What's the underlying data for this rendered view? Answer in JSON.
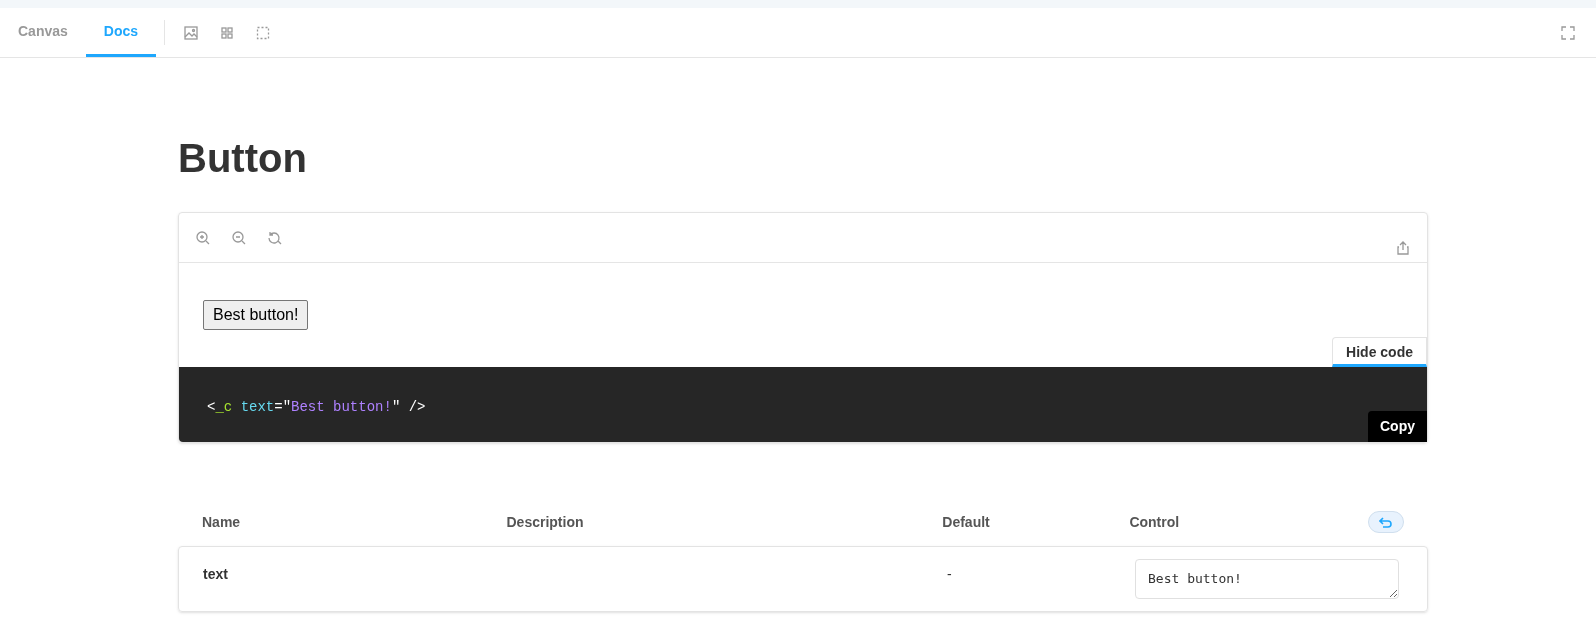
{
  "tabs": [
    {
      "label": "Canvas",
      "selected": false
    },
    {
      "label": "Docs",
      "selected": true
    }
  ],
  "title": "Button",
  "preview": {
    "button_label": "Best button!",
    "toggle_label": "Hide code",
    "code_shown": true,
    "code": [
      {
        "kind": "punct",
        "text": "<"
      },
      {
        "kind": "tag",
        "text": "_c "
      },
      {
        "kind": "attr",
        "text": "text"
      },
      {
        "kind": "punct",
        "text": "="
      },
      {
        "kind": "quote",
        "text": "\""
      },
      {
        "kind": "string",
        "text": "Best button!"
      },
      {
        "kind": "quote",
        "text": "\" "
      },
      {
        "kind": "punct",
        "text": "/>"
      }
    ],
    "copy_label": "Copy"
  },
  "table": {
    "columns": [
      "Name",
      "Description",
      "Default",
      "Control"
    ],
    "rows": [
      {
        "name": "text",
        "description": "",
        "default": "-",
        "control_value": "Best button!"
      }
    ]
  }
}
